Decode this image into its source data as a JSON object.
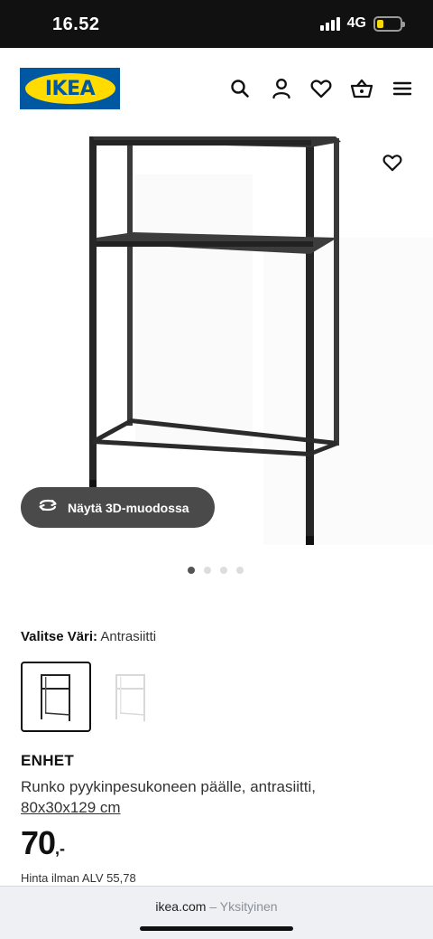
{
  "status_bar": {
    "time": "16.52",
    "network": "4G",
    "battery_level": 0.3
  },
  "header": {
    "logo_text": "IKEA",
    "icons": [
      "search-icon",
      "account-icon",
      "heart-icon",
      "basket-icon",
      "menu-icon"
    ]
  },
  "gallery": {
    "view_3d_label": "Näytä 3D-muodossa",
    "image_count": 4,
    "active_index": 0
  },
  "color_selector": {
    "label": "Valitse Väri:",
    "selected": "Antrasiitti"
  },
  "product": {
    "name": "ENHET",
    "description": "Runko pyykinpesukoneen päälle, antrasiitti,",
    "dimensions": "80x30x129 cm",
    "price": "70",
    "price_suffix": ",-",
    "price_ex_vat": "Hinta ilman ALV 55,78"
  },
  "browser": {
    "domain": "ikea.com",
    "separator": "–",
    "mode": "Yksityinen"
  },
  "colors": {
    "ikea_blue": "#0058a3",
    "ikea_yellow": "#ffdb00",
    "shelf_anthracite": "#2f2f2f"
  }
}
